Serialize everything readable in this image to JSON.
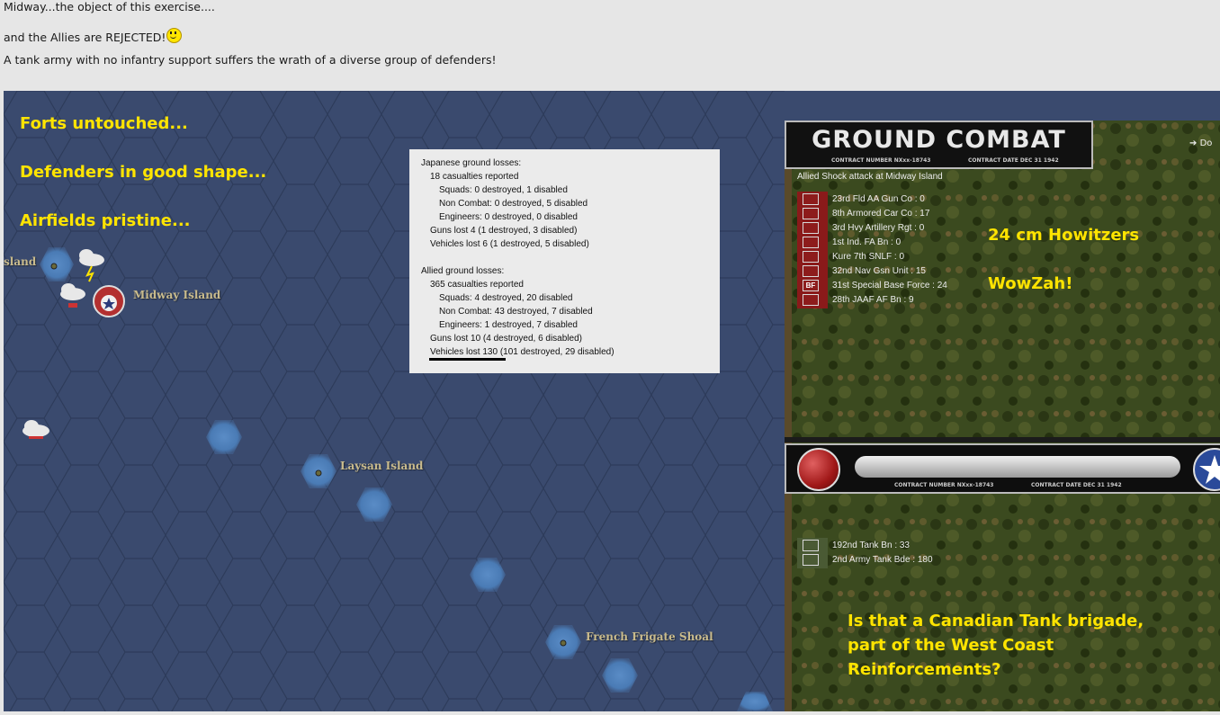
{
  "post": {
    "line1": "Midway...the object of this exercise....",
    "line2": "and the Allies are REJECTED!",
    "line3": "A tank army with no infantry support suffers the wrath of a diverse group of defenders!"
  },
  "map": {
    "annotations": [
      "Forts untouched...",
      "Defenders in good shape...",
      "Airfields pristine..."
    ],
    "places": {
      "island_partial": "sland",
      "midway": "Midway Island",
      "laysan": "Laysan Island",
      "french_frigate": "French Frigate Shoal"
    }
  },
  "losses": {
    "japanese": {
      "header": "Japanese ground losses:",
      "casualties": "18 casualties reported",
      "squads": "Squads: 0 destroyed, 1 disabled",
      "noncombat": "Non Combat: 0 destroyed, 5 disabled",
      "engineers": "Engineers: 0 destroyed, 0 disabled",
      "guns": "Guns lost 4 (1 destroyed, 3 disabled)",
      "vehicles": "Vehicles lost 6 (1 destroyed, 5 disabled)"
    },
    "allied": {
      "header": "Allied ground losses:",
      "casualties": "365 casualties reported",
      "squads": "Squads: 4 destroyed, 20 disabled",
      "noncombat": "Non Combat: 43 destroyed, 7 disabled",
      "engineers": "Engineers: 1 destroyed, 7 disabled",
      "guns": "Guns lost 10 (4 destroyed, 6 disabled)",
      "vehicles": "Vehicles lost 130 (101 destroyed, 29 disabled)"
    }
  },
  "combat": {
    "banner_title": "GROUND COMBAT",
    "contract_number": "CONTRACT NUMBER",
    "contract_code": "NXxx-18743",
    "contract_date": "CONTRACT DATE",
    "contract_date_value": "DEC 31 1942",
    "corner_label": "Do",
    "attack_title": "Allied Shock attack at Midway Island",
    "defenders": [
      {
        "label": "23rd Fld AA Gun Co : 0",
        "icon": "triangle-icon"
      },
      {
        "label": "8th Armored Car Co : 17",
        "icon": "armor-icon"
      },
      {
        "label": "3rd Hvy Artillery Rgt : 0",
        "icon": "artillery-icon"
      },
      {
        "label": "1st Ind. FA Bn : 0",
        "icon": "artillery-icon"
      },
      {
        "label": "Kure 7th SNLF : 0",
        "icon": "marine-icon"
      },
      {
        "label": "32nd Nav Gsn Unit : 15",
        "icon": "infantry-icon"
      },
      {
        "label": "31st Special Base Force : 24",
        "icon": "base-force-icon"
      },
      {
        "label": "28th JAAF AF Bn : 9",
        "icon": "airfield-icon"
      }
    ],
    "bf_text": "BF",
    "attackers": [
      {
        "label": "192nd Tank Bn : 33",
        "icon": "tank-icon"
      },
      {
        "label": "2nd Army Tank Bde : 180",
        "icon": "tank-icon"
      }
    ],
    "notes": {
      "howitzers": "24 cm Howitzers",
      "wowzah": "WowZah!",
      "canadian1": "Is that a Canadian Tank brigade,",
      "canadian2": "part of the West Coast",
      "canadian3": "Reinforcements?"
    }
  },
  "colors": {
    "annotation": "#ffe400",
    "ocean": "#3a4a6e",
    "shoal": "#4f7fb8",
    "japanese_unit": "#8d1c1c",
    "allied_unit": "#4a5a34"
  }
}
